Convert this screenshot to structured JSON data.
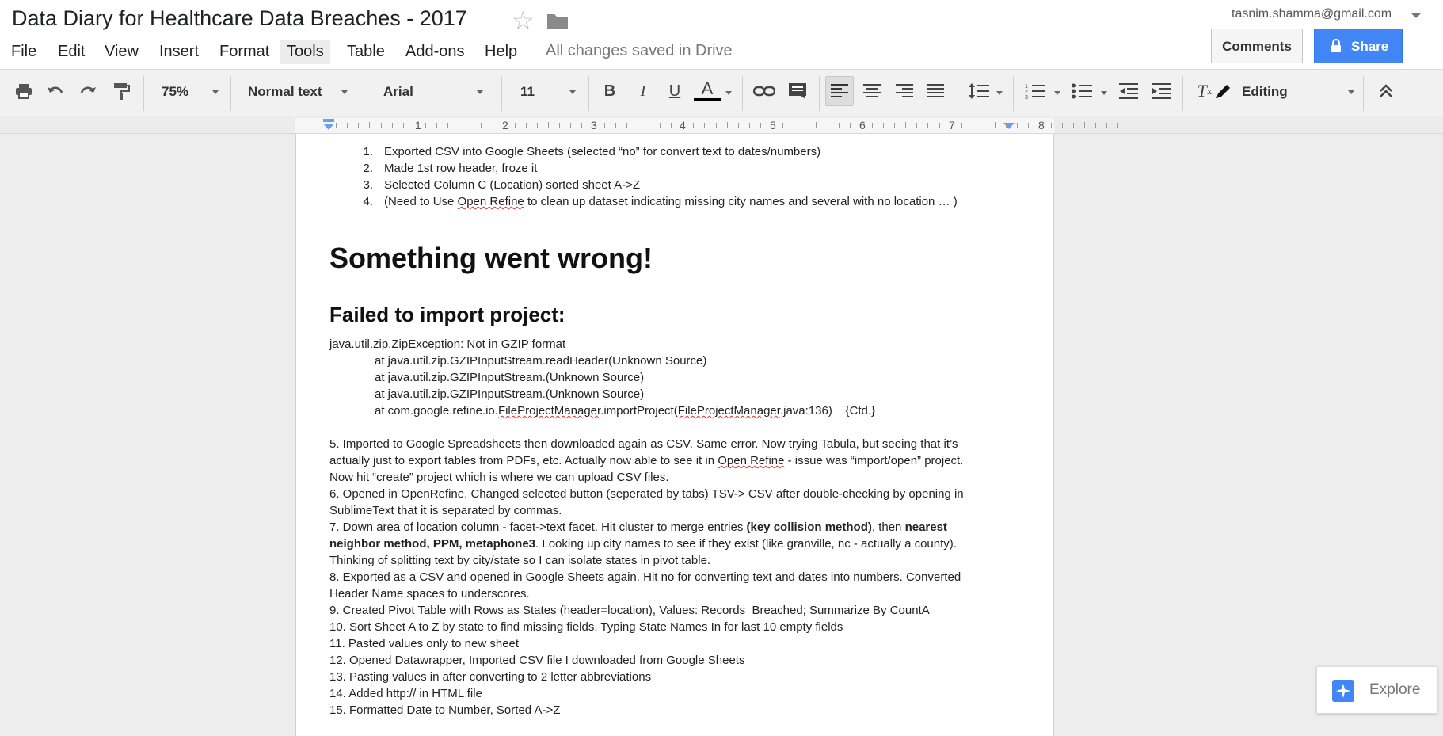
{
  "header": {
    "doc_title": "Data Diary for Healthcare Data Breaches - 2017",
    "account": "tasnim.shamma@gmail.com",
    "save_status": "All changes saved in Drive",
    "comments_label": "Comments",
    "share_label": "Share"
  },
  "menu": [
    "File",
    "Edit",
    "View",
    "Insert",
    "Format",
    "Tools",
    "Table",
    "Add-ons",
    "Help"
  ],
  "toolbar": {
    "zoom": "75%",
    "style": "Normal text",
    "font": "Arial",
    "size": "11",
    "mode": "Editing"
  },
  "ruler": [
    "1",
    "2",
    "3",
    "4",
    "5",
    "6",
    "7",
    "8"
  ],
  "doc": {
    "list": [
      {
        "num": "1.",
        "text": "Exported CSV into Google Sheets (selected “no” for convert text to dates/numbers)"
      },
      {
        "num": "2.",
        "text": "Made 1st row header, froze it"
      },
      {
        "num": "3.",
        "text": "Selected Column C (Location) sorted sheet A->Z"
      },
      {
        "num": "4.",
        "text_a": "(Need to Use ",
        "text_spell": "Open Refine",
        "text_b": " to clean up dataset indicating missing city names and several with no location … )"
      }
    ],
    "heading1": "Something went wrong!",
    "heading2": "Failed to import project:",
    "stack": [
      "java.util.zip.ZipException: Not in GZIP format",
      "at java.util.zip.GZIPInputStream.readHeader(Unknown Source)",
      "at java.util.zip.GZIPInputStream.(Unknown Source)",
      "at java.util.zip.GZIPInputStream.(Unknown Source)"
    ],
    "stack_last": {
      "a": "at com.google.refine.io.",
      "s1": "FileProjectManager",
      "b": ".importProject(",
      "s2": "FileProjectManager",
      "c": ".java:136)    {Ctd.}"
    },
    "p5_l1": "5. Imported to Google Spreadsheets then downloaded again as CSV. Same error. Now trying Tabula, but seeing that it’s",
    "p5_l2a": "actually just to export tables from PDFs, etc. Actually now able to see it in ",
    "p5_l2s": "Open Refine",
    "p5_l2b": " - issue was “import/open” project.",
    "p5_l3": "Now hit “create” project which is where we can upload CSV files.",
    "p6_l1": "6. Opened in OpenRefine. Changed selected button (seperated by tabs) TSV-> CSV after double-checking by opening in",
    "p6_l2": "SublimeText that it is separated by commas.",
    "p7_l1a": "7. Down area of location column - facet->text facet. Hit cluster to merge entries ",
    "p7_l1b": "(key collision method)",
    "p7_l1c": ", then ",
    "p7_l1d": "nearest",
    "p7_l2a": "neighbor method, PPM, metaphone3",
    "p7_l2b": ". Looking up city names to see if they exist (like granville, nc - actually a county).",
    "p7_l3": "Thinking of splitting text by city/state so I can isolate states in pivot table.",
    "p8_l1": "8. Exported as a CSV and opened in Google Sheets again. Hit no for converting text and dates into numbers. Converted",
    "p8_l2": "Header Name spaces to underscores.",
    "p9": "9. Created Pivot Table with Rows as States (header=location), Values: Records_Breached; Summarize By CountA",
    "p10": "10. Sort Sheet A to Z by state to find missing fields. Typing State Names In for last 10 empty fields",
    "p11": "11. Pasted values only to new sheet",
    "p12": "12. Opened Datawrapper, Imported CSV file I downloaded from Google Sheets",
    "p13": "13. Pasting values in after converting to 2 letter abbreviations",
    "p14": "14. Added http:// in HTML file",
    "p15": "15. Formatted Date to Number, Sorted A->Z"
  },
  "explore_label": "Explore",
  "colors": {
    "accent": "#4285f4",
    "explore_icon": "#4285f4",
    "spell_underline": "#dd3333"
  }
}
